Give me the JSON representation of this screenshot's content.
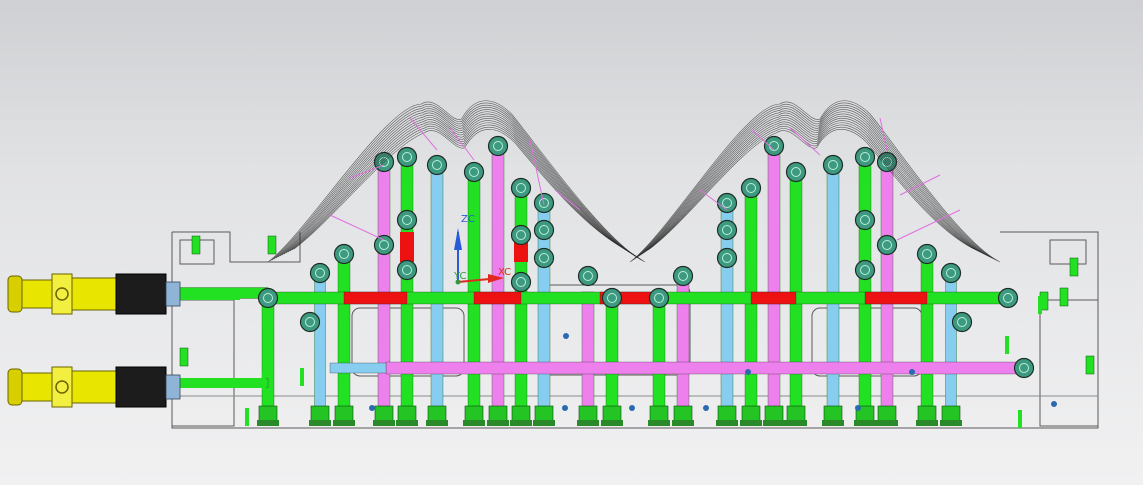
{
  "axes": {
    "z_label": "ZC",
    "x_label": "XC",
    "y_label": "YC",
    "z_color": "#2a5bd8",
    "x_color": "#e0281e",
    "y_color": "#2e9a3a"
  },
  "colors": {
    "background_top": "#cfd0d3",
    "background_bottom": "#f1f1f2",
    "mold_outline": "#5a5a5a",
    "channel_green": "#22e022",
    "channel_pink": "#ee80ee",
    "channel_blue": "#87cdf0",
    "channel_red": "#ee1111",
    "plug_teal": "#3d9a80",
    "connector_yellow": "#e8e600",
    "connector_black": "#1c1c1c",
    "part_wireframe": "#2b2b2b"
  },
  "icons": {
    "coordinate_triad": "xyz-triad-icon",
    "connector": "quick-coupler-icon",
    "plug": "channel-plug-icon"
  }
}
